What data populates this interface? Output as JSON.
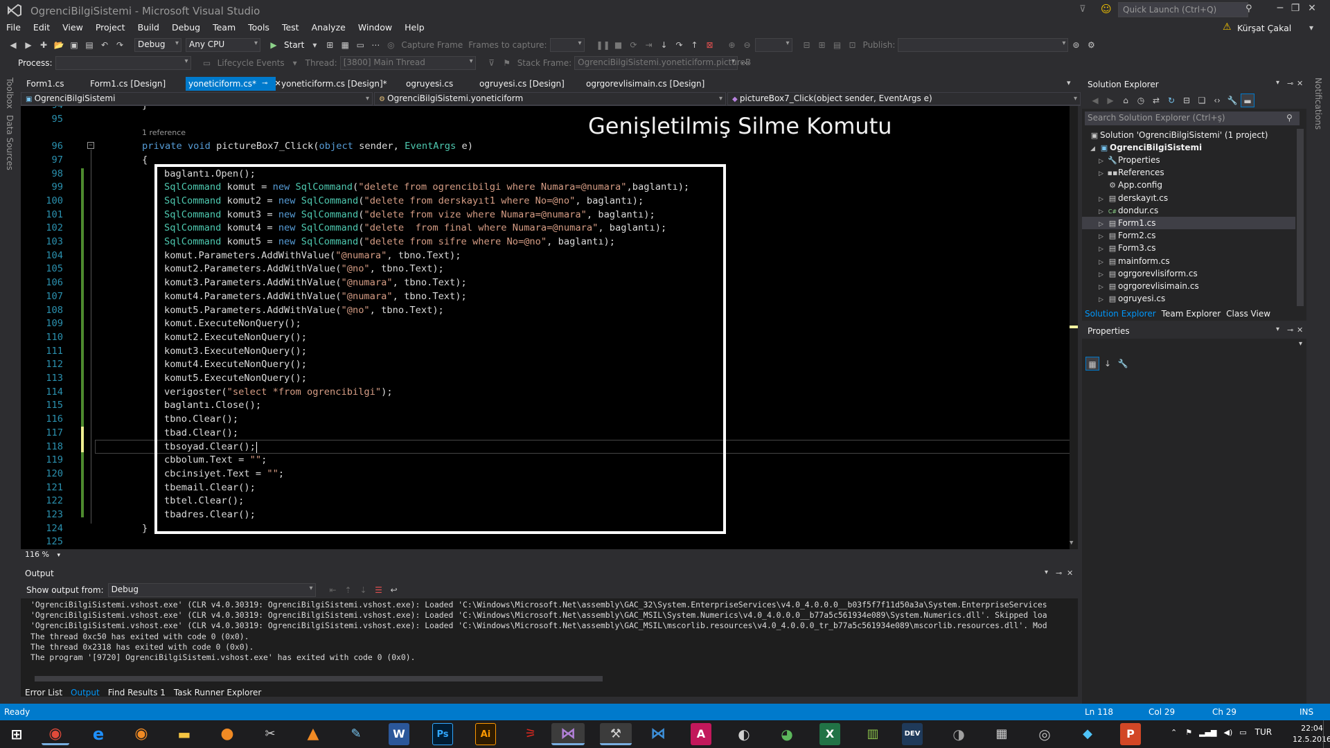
{
  "window": {
    "title": "OgrenciBilgiSistemi - Microsoft Visual Studio",
    "quick_launch_placeholder": "Quick Launch (Ctrl+Q)",
    "user_name": "Kürşat Çakal"
  },
  "menu": [
    "File",
    "Edit",
    "View",
    "Project",
    "Build",
    "Debug",
    "Team",
    "Tools",
    "Test",
    "Analyze",
    "Window",
    "Help"
  ],
  "toolbar": {
    "config": "Debug",
    "platform": "Any CPU",
    "start_label": "Start",
    "capture_frame": "Capture Frame",
    "frames_to_capture": "Frames to capture:",
    "publish_label": "Publish:"
  },
  "debug_toolbar": {
    "process_label": "Process:",
    "lifecycle_events": "Lifecycle Events",
    "thread_label": "Thread:",
    "thread_value": "[3800] Main Thread",
    "stack_frame_label": "Stack Frame:",
    "stack_frame_value": "OgrenciBilgiSistemi.yoneticiform.pictureB"
  },
  "side_tabs": {
    "toolbox": "Toolbox",
    "data_sources": "Data Sources",
    "notifications": "Notifications"
  },
  "doc_tabs": [
    {
      "label": "Form1.cs",
      "active": false
    },
    {
      "label": "Form1.cs [Design]",
      "active": false
    },
    {
      "label": "yoneticiform.cs*",
      "active": true
    },
    {
      "label": "yoneticiform.cs [Design]*",
      "active": false
    },
    {
      "label": "ogruyesi.cs",
      "active": false
    },
    {
      "label": "ogruyesi.cs [Design]",
      "active": false
    },
    {
      "label": "ogrgorevlisimain.cs [Design]",
      "active": false
    }
  ],
  "navbar": {
    "project": "OgrenciBilgiSistemi",
    "class": "OgrenciBilgiSistemi.yoneticiform",
    "member": "pictureBox7_Click(object sender, EventArgs e)"
  },
  "editor": {
    "overlay_title": "Genişletilmiş Silme Komutu",
    "zoom": "116 %",
    "line_numbers": [
      "94",
      "95",
      "",
      "96",
      "97",
      "98",
      "99",
      "100",
      "101",
      "102",
      "103",
      "104",
      "105",
      "106",
      "107",
      "108",
      "109",
      "110",
      "111",
      "112",
      "113",
      "114",
      "115",
      "116",
      "117",
      "118",
      "119",
      "120",
      "121",
      "122",
      "123",
      "124",
      "125"
    ],
    "reference_hint": "1 reference",
    "lines": {
      "l94": "}",
      "l96_kw1": "private",
      "l96_kw2": "void",
      "l96_name": " pictureBox7_Click(",
      "l96_kw3": "object",
      "l96_mid": " sender, ",
      "l96_ty": "EventArgs",
      "l96_end": " e)",
      "l97": "{",
      "l98": "baglantı.Open();",
      "l99_ty": "SqlCommand",
      "l99_a": " komut = ",
      "l99_kw": "new",
      "l99_ty2": " SqlCommand",
      "l99_b": "(",
      "l99_st": "\"delete from ogrencibilgi where Numara=@numara\"",
      "l99_c": ",baglantı);",
      "l100_ty": "SqlCommand",
      "l100_a": " komut2 = ",
      "l100_kw": "new",
      "l100_ty2": " SqlCommand",
      "l100_b": "(",
      "l100_st": "\"delete from derskayıt1 where No=@no\"",
      "l100_c": ", baglantı);",
      "l101_ty": "SqlCommand",
      "l101_a": " komut3 = ",
      "l101_kw": "new",
      "l101_ty2": " SqlCommand",
      "l101_b": "(",
      "l101_st": "\"delete from vize where Numara=@numara\"",
      "l101_c": ", baglantı);",
      "l102_ty": "SqlCommand",
      "l102_a": " komut4 = ",
      "l102_kw": "new",
      "l102_ty2": " SqlCommand",
      "l102_b": "(",
      "l102_st": "\"delete  from final where Numara=@numara\"",
      "l102_c": ", baglantı);",
      "l103_ty": "SqlCommand",
      "l103_a": " komut5 = ",
      "l103_kw": "new",
      "l103_ty2": " SqlCommand",
      "l103_b": "(",
      "l103_st": "\"delete from sifre where No=@no\"",
      "l103_c": ", baglantı);",
      "l104_a": "komut.Parameters.AddWithValue(",
      "l104_st": "\"@numara\"",
      "l104_b": ", tbno.Text);",
      "l105_a": "komut2.Parameters.AddWithValue(",
      "l105_st": "\"@no\"",
      "l105_b": ", tbno.Text);",
      "l106_a": "komut3.Parameters.AddWithValue(",
      "l106_st": "\"@numara\"",
      "l106_b": ", tbno.Text);",
      "l107_a": "komut4.Parameters.AddWithValue(",
      "l107_st": "\"@numara\"",
      "l107_b": ", tbno.Text);",
      "l108_a": "komut5.Parameters.AddWithValue(",
      "l108_st": "\"@no\"",
      "l108_b": ", tbno.Text);",
      "l109": "komut.ExecuteNonQuery();",
      "l110": "komut2.ExecuteNonQuery();",
      "l111": "komut3.ExecuteNonQuery();",
      "l112": "komut4.ExecuteNonQuery();",
      "l113": "komut5.ExecuteNonQuery();",
      "l114_a": "verigoster(",
      "l114_st": "\"select *from ogrencibilgi\"",
      "l114_b": ");",
      "l115": "baglantı.Close();",
      "l116": "tbno.Clear();",
      "l117": "tbad.Clear();",
      "l118": "tbsoyad.Clear();",
      "l119_a": "cbbolum.Text = ",
      "l119_st": "\"\"",
      "l119_b": ";",
      "l120_a": "cbcinsiyet.Text = ",
      "l120_st": "\"\"",
      "l120_b": ";",
      "l121": "tbemail.Clear();",
      "l122": "tbtel.Clear();",
      "l123": "tbadres.Clear();",
      "l124": "}"
    }
  },
  "output": {
    "title": "Output",
    "show_from_label": "Show output from:",
    "show_from_value": "Debug",
    "text": "'OgrenciBilgiSistemi.vshost.exe' (CLR v4.0.30319: OgrenciBilgiSistemi.vshost.exe): Loaded 'C:\\Windows\\Microsoft.Net\\assembly\\GAC_32\\System.EnterpriseServices\\v4.0_4.0.0.0__b03f5f7f11d50a3a\\System.EnterpriseServices\n'OgrenciBilgiSistemi.vshost.exe' (CLR v4.0.30319: OgrenciBilgiSistemi.vshost.exe): Loaded 'C:\\Windows\\Microsoft.Net\\assembly\\GAC_MSIL\\System.Numerics\\v4.0_4.0.0.0__b77a5c561934e089\\System.Numerics.dll'. Skipped loa\n'OgrenciBilgiSistemi.vshost.exe' (CLR v4.0.30319: OgrenciBilgiSistemi.vshost.exe): Loaded 'C:\\Windows\\Microsoft.Net\\assembly\\GAC_MSIL\\mscorlib.resources\\v4.0_4.0.0.0_tr_b77a5c561934e089\\mscorlib.resources.dll'. Mod\nThe thread 0xc50 has exited with code 0 (0x0).\nThe thread 0x2318 has exited with code 0 (0x0).\nThe program '[9720] OgrenciBilgiSistemi.vshost.exe' has exited with code 0 (0x0)."
  },
  "bottom_tabs": [
    "Error List",
    "Output",
    "Find Results 1",
    "Task Runner Explorer"
  ],
  "solution_explorer": {
    "title": "Solution Explorer",
    "search_placeholder": "Search Solution Explorer (Ctrl+ş)",
    "solution": "Solution 'OgrenciBilgiSistemi' (1 project)",
    "project": "OgrenciBilgiSistemi",
    "items": [
      "Properties",
      "References",
      "App.config",
      "derskayıt.cs",
      "dondur.cs",
      "Form1.cs",
      "Form2.cs",
      "Form3.cs",
      "mainform.cs",
      "ogrgorevlisiform.cs",
      "ogrgorevlisimain.cs",
      "ogruyesi.cs"
    ],
    "tabs": [
      "Solution Explorer",
      "Team Explorer",
      "Class View"
    ]
  },
  "properties": {
    "title": "Properties"
  },
  "status": {
    "state": "Ready",
    "line": "Ln 118",
    "col": "Col 29",
    "ch": "Ch 29",
    "mode": "INS"
  },
  "taskbar": {
    "lang": "TUR",
    "time": "22:04",
    "date": "12.5.2016",
    "apps": [
      "W",
      "Ps",
      "Ai",
      "DEV"
    ]
  }
}
